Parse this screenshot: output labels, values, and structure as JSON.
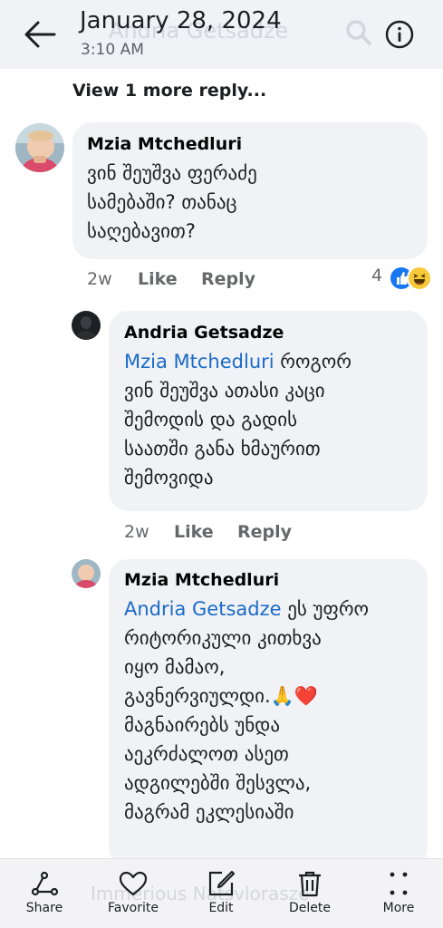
{
  "header": {
    "date": "January 28, 2024",
    "time": "3:10 AM",
    "ghost_title": "Andria Getsadze"
  },
  "view_more": "View 1 more reply...",
  "comments": [
    {
      "author": "Mzia Mtchedluri",
      "text": "ვინ შეუშვა ფერაძე სამებაში? თანაც საღებავით?",
      "time": "2w",
      "like": "Like",
      "reply": "Reply",
      "reaction_count": "4"
    },
    {
      "author": "Andria Getsadze",
      "mention": "Mzia Mtchedluri",
      "text_lines": [
        "როგორ",
        "ვინ შეუშვა ათასი კაცი",
        "შემოდის და გადის",
        "საათში განა ხმაურით",
        "შემოვიდა"
      ],
      "time": "2w",
      "like": "Like",
      "reply": "Reply"
    },
    {
      "author": "Mzia Mtchedluri",
      "mention": "Andria Getsadze",
      "text_lines": [
        "ეს უფრო",
        "რიტორიკული კითხვა",
        "იყო მამაო,",
        "გავნერვიულდი.🙏❤️",
        "მაგნაირებს უნდა",
        "აეკრძალოთ ასეთ",
        "ადგილებში შესვლა,",
        "მაგრამ ეკლესიაში"
      ]
    }
  ],
  "bottom_bar": {
    "ghost_text": "Immerious Natsvlorasze",
    "items": [
      {
        "label": "Share",
        "icon": "share-icon"
      },
      {
        "label": "Favorite",
        "icon": "heart-icon"
      },
      {
        "label": "Edit",
        "icon": "edit-icon"
      },
      {
        "label": "Delete",
        "icon": "trash-icon"
      },
      {
        "label": "More",
        "icon": "more-icon"
      }
    ]
  },
  "colors": {
    "mention": "#1a6ac9",
    "bubble": "#f0f2f5",
    "header_bg": "#f1f2f6"
  }
}
